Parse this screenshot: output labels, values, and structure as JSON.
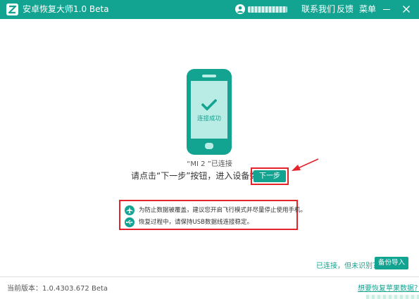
{
  "app": {
    "title": "安卓恢复大师1.0 Beta"
  },
  "header": {
    "links": [
      "联系我们",
      "反馈",
      "菜单"
    ]
  },
  "phone": {
    "status_text": "连接成功"
  },
  "device": {
    "label": "“MI 2 ”已连接"
  },
  "instruction": {
    "text": "请点击“下一步”按钮，进入设备数据扫描"
  },
  "next_button": {
    "label": "下一步"
  },
  "tips": [
    "为防止数据被覆盖，建议您开启飞行模式并尽量停止使用手机。",
    "恢复过程中，请保持USB数据线连接稳定。"
  ],
  "bottom": {
    "unrecognized_link": "已连接，但未识别？",
    "backup_button": "备份导入",
    "version": "当前版本：1.0.4303.672 Beta",
    "apple_link": "想要恢复苹果数据？"
  },
  "colors": {
    "accent": "#13a391",
    "highlight": "#e5232b",
    "screen": "#b9ece4"
  }
}
